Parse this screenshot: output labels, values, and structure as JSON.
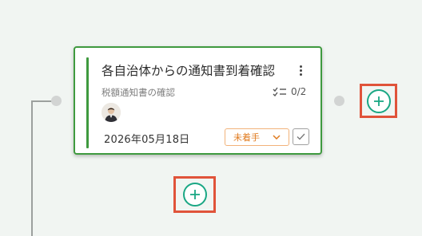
{
  "card": {
    "title": "各自治体からの通知書到着確認",
    "subtitle": "税額通知書の確認",
    "checklist_progress": "0/2",
    "due_date": "2026年05月18日",
    "status_label": "未着手"
  },
  "colors": {
    "accent_green": "#3f9a3f",
    "add_button_teal": "#1aa784",
    "highlight_red": "#e0533a",
    "status_orange": "#e07b1f"
  },
  "icons": [
    "kebab-menu-icon",
    "checklist-icon",
    "chevron-down-icon",
    "checkmark-icon",
    "plus-icon"
  ]
}
